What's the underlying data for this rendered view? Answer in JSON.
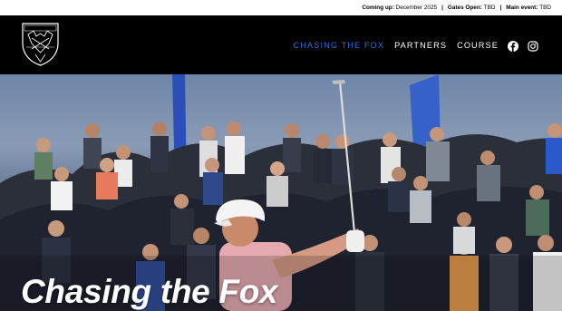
{
  "topbar": {
    "coming_up_label": "Coming up:",
    "coming_up_value": "December 2025",
    "gates_label": "Gates Open:",
    "gates_value": "TBD",
    "main_event_label": "Main event:",
    "main_event_value": "TBD",
    "separator": "|"
  },
  "logo": {
    "text": "CHASING THE FOX",
    "icon": "fox-crest-shield-icon"
  },
  "nav": {
    "items": [
      {
        "label": "CHASING THE FOX",
        "active": true
      },
      {
        "label": "PARTNERS",
        "active": false
      },
      {
        "label": "COURSE",
        "active": false
      }
    ],
    "social": [
      "facebook-icon",
      "instagram-icon"
    ]
  },
  "hero": {
    "title": "Chasing the Fox"
  },
  "colors": {
    "accent": "#2f6fd8",
    "header_bg": "#000000",
    "topbar_bg": "#ffffff",
    "text_light": "#ffffff"
  }
}
